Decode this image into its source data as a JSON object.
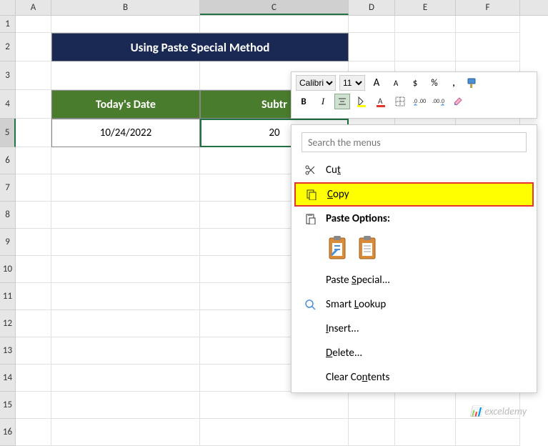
{
  "columns": [
    "A",
    "B",
    "C",
    "D",
    "E",
    "F"
  ],
  "rows": [
    "1",
    "2",
    "3",
    "4",
    "5",
    "6",
    "7",
    "8",
    "9",
    "10",
    "11",
    "12",
    "13",
    "14",
    "15",
    "16"
  ],
  "title": "Using Paste Special Method",
  "headers": {
    "b4": "Today's Date",
    "c4": "Subtr"
  },
  "data": {
    "b5": "10/24/2022",
    "c5": "20"
  },
  "toolbar": {
    "font": "Calibri",
    "size": "11",
    "increase_font": "A",
    "decrease_font": "A",
    "currency": "$",
    "percent": "%",
    "comma": ",",
    "bold": "B",
    "italic": "I"
  },
  "menu": {
    "search_placeholder": "Search the menus",
    "cut": "Cut",
    "copy": "Copy",
    "paste_options": "Paste Options:",
    "paste_special": "Paste Special...",
    "smart_lookup": "Smart Lookup",
    "insert": "Insert...",
    "delete": "Delete...",
    "clear_contents": "Clear Contents"
  },
  "watermark": "exceldemy"
}
